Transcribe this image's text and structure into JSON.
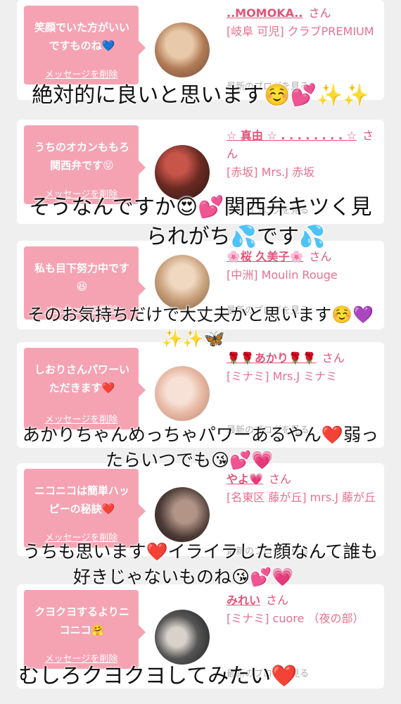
{
  "cards": [
    {
      "message": "笑顔でいた方がいいですものね💙",
      "delete_label": "メッセージを削除",
      "name": "..MOMOKA..",
      "san": "さん",
      "shop": "[岐阜 可児] クラブPREMIUM",
      "blog_label": "最新のブログを見る",
      "avatar_colors": [
        "#b07a55",
        "#e8c9a9"
      ]
    },
    {
      "message": "うちのオカンももろ関西弁です😝",
      "delete_label": "メッセージを削除",
      "name": "☆ 真由 ☆ . . . . . . . . ☆",
      "san": "さん",
      "shop": "[赤坂] Mrs.J 赤坂",
      "blog_label": "最新のブログを見る",
      "avatar_colors": [
        "#3a1f1a",
        "#c8554a"
      ]
    },
    {
      "message": "私も目下努力中です😆",
      "delete_label": "メッセージを削除",
      "name": "🌸桜 久美子🌸",
      "san": "さん",
      "shop": "[中洲] Moulin Rouge",
      "blog_label": "最新のブログを見る",
      "avatar_colors": [
        "#c9a07b",
        "#f0d8c0"
      ]
    },
    {
      "message": "しおりさんパワーいただきます❤️",
      "delete_label": "メッセージを削除",
      "name": "🌹🌹あかり🌹🌹",
      "san": "さん",
      "shop": "[ミナミ] Mrs.J ミナミ",
      "blog_label": "最新のブログを見る",
      "avatar_colors": [
        "#e6b7a2",
        "#f7e1d6"
      ]
    },
    {
      "message": "ニコニコは簡単ハッピーの秘訣❤️",
      "delete_label": "メッセージを削除",
      "name": "やよ💗",
      "san": "さん",
      "shop": "[名東区 藤が丘] mrs.J 藤が丘",
      "blog_label": "最新のブログを見る",
      "avatar_colors": [
        "#4b3a36",
        "#b29586"
      ]
    },
    {
      "message": "クヨクヨするよりニコニコ🤗",
      "delete_label": "メッセージを削除",
      "name": "みれい",
      "san": "さん",
      "shop": "[ミナミ] cuore （夜の部）",
      "blog_label": "最新のブログを見る",
      "avatar_colors": [
        "#2a2a2a",
        "#d9d2cc"
      ]
    }
  ],
  "overlays": [
    {
      "lines": [
        "絶対的に良いと思います☺️💕✨✨"
      ]
    },
    {
      "lines": [
        "そうなんですか😍💕関西弁キツく見",
        "られがち💦です💦"
      ]
    },
    {
      "lines": [
        "そのお気持ちだけで大丈夫かと思います☺️💜",
        "✨✨🦋"
      ]
    },
    {
      "lines": [
        "あかりちゃんめっちゃパワーあるやん❤️弱っ",
        "たらいつでも😘💕💗"
      ]
    },
    {
      "lines": [
        "うちも思います❤️イライラした顔なんて誰も",
        "好きじゃないものね😘💕💗"
      ]
    },
    {
      "lines": [
        "むしろクヨクヨしてみたい❤️"
      ]
    }
  ]
}
